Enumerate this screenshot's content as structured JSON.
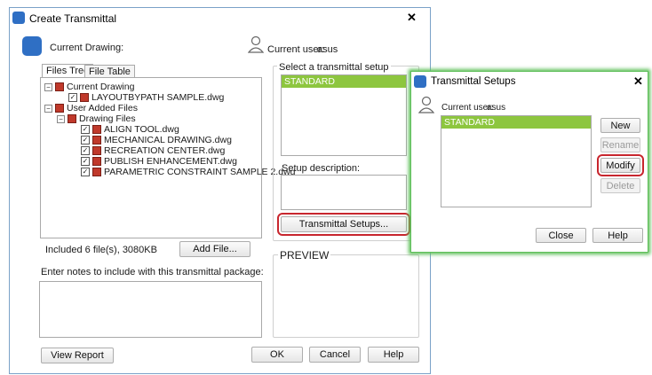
{
  "main_dialog": {
    "title": "Create Transmittal",
    "current_drawing_label": "Current Drawing:",
    "current_user_label": "Current user:",
    "current_user_value": "asus",
    "tabs": [
      "Files Tree",
      "File Table"
    ],
    "tree": [
      {
        "label": "Current Drawing",
        "level": 0,
        "type": "folder"
      },
      {
        "label": "LAYOUTBYPATH SAMPLE.dwg",
        "level": 1,
        "type": "file"
      },
      {
        "label": "User Added Files",
        "level": 0,
        "type": "folder"
      },
      {
        "label": "Drawing Files",
        "level": 1,
        "type": "folder"
      },
      {
        "label": "ALIGN TOOL.dwg",
        "level": 2,
        "type": "file"
      },
      {
        "label": "MECHANICAL DRAWING.dwg",
        "level": 2,
        "type": "file"
      },
      {
        "label": "RECREATION CENTER.dwg",
        "level": 2,
        "type": "file"
      },
      {
        "label": "PUBLISH ENHANCEMENT.dwg",
        "level": 2,
        "type": "file"
      },
      {
        "label": "PARAMETRIC CONSTRAINT SAMPLE 2.dwg",
        "level": 2,
        "type": "file"
      }
    ],
    "included_text": "Included 6 file(s), 3080KB",
    "add_file_button": "Add File...",
    "notes_label": "Enter notes to include with this transmittal package:",
    "select_setup_label": "Select a transmittal setup",
    "setups": [
      "STANDARD"
    ],
    "setup_description_label": "Setup description:",
    "transmittal_setups_button": "Transmittal Setups...",
    "preview_label": "PREVIEW",
    "view_report_button": "View Report",
    "ok_button": "OK",
    "cancel_button": "Cancel",
    "help_button": "Help"
  },
  "setups_dialog": {
    "title": "Transmittal Setups",
    "current_user_label": "Current user:",
    "current_user_value": "asus",
    "setups": [
      "STANDARD"
    ],
    "new_button": "New",
    "rename_button": "Rename",
    "modify_button": "Modify",
    "delete_button": "Delete",
    "close_button": "Close",
    "help_button": "Help"
  },
  "colors": {
    "selection": "#8dc63f",
    "highlight": "#c8262e",
    "accent": "#2f6fc4"
  },
  "icons": {
    "close": "close-icon",
    "user": "user-icon",
    "app": "autocad-icon"
  }
}
